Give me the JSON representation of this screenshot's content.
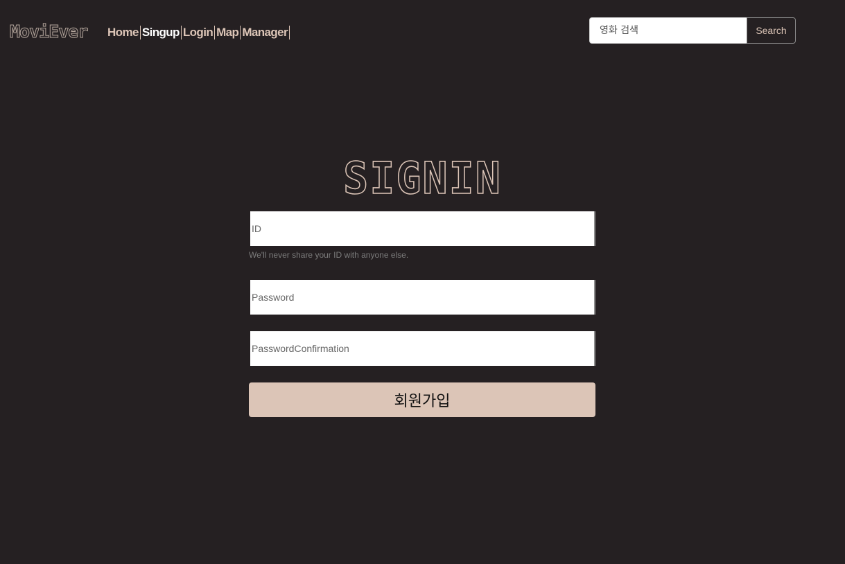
{
  "navbar": {
    "brand": "MoviEver",
    "links": [
      {
        "label": "Home",
        "active": false
      },
      {
        "label": "Singup",
        "active": true
      },
      {
        "label": "Login",
        "active": false
      },
      {
        "label": "Map",
        "active": false
      },
      {
        "label": "Manager",
        "active": false
      }
    ],
    "search": {
      "placeholder": "영화 검색",
      "button_label": "Search"
    }
  },
  "main": {
    "title": "SIGNIN",
    "id_field": {
      "placeholder": "ID"
    },
    "id_help": "We'll never share your ID with anyone else.",
    "password_field": {
      "placeholder": "Password"
    },
    "confirm_field": {
      "placeholder": "PasswordConfirmation"
    },
    "submit_label": "회원가입"
  },
  "colors": {
    "background": "#252022",
    "accent": "#dcc5b7",
    "active_link": "#ffffff"
  }
}
